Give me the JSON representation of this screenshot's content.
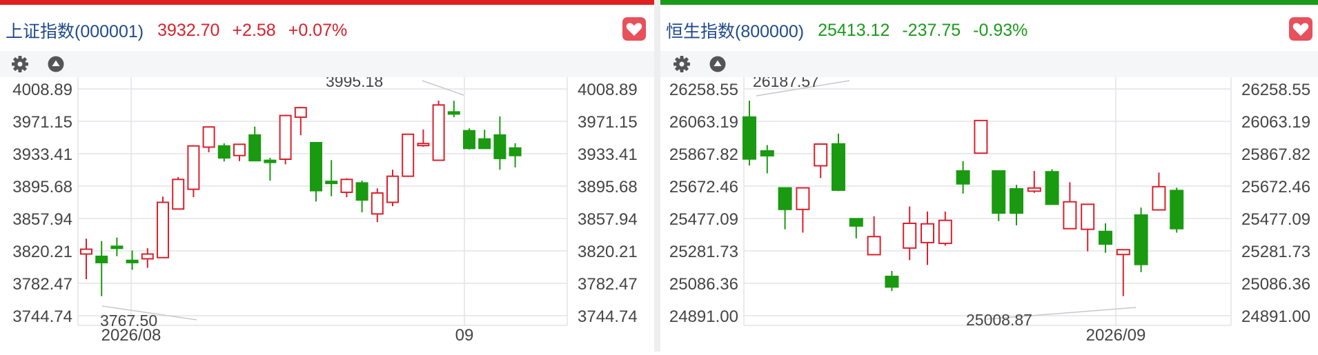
{
  "panels": [
    {
      "name": "上证指数(000001)",
      "price": "3932.70",
      "change": "+2.58",
      "change_pct": "+0.07%",
      "accent_color": "#e02020",
      "value_color": "#d9202c",
      "toolbar_icons": [
        "gear-icon",
        "triangle-up-icon"
      ],
      "favorite_icon": "heart-icon"
    },
    {
      "name": "恒生指数(800000)",
      "price": "25413.12",
      "change": "-237.75",
      "change_pct": "-0.93%",
      "accent_color": "#1a9a1a",
      "value_color": "#1a9a1a",
      "toolbar_icons": [
        "gear-icon",
        "triangle-up-icon"
      ],
      "favorite_icon": "heart-icon"
    }
  ],
  "colors": {
    "up": "#d9202c",
    "down": "#1a9a10",
    "favorite": "#e8505b",
    "grid": "#e2e4e8",
    "axis_text": "#444444"
  },
  "chart_data": [
    {
      "type": "candlestick",
      "title": "上证指数(000001)",
      "y_ticks": [
        "4008.89",
        "3971.15",
        "3933.41",
        "3895.68",
        "3857.94",
        "3820.21",
        "3782.47",
        "3744.74"
      ],
      "ylim": [
        3744.74,
        4008.89
      ],
      "x_tick_labels": [
        {
          "label": "2026/08",
          "index": 2
        },
        {
          "label": "09",
          "index": 21
        }
      ],
      "annotations": [
        {
          "text": "3995.18",
          "index": 20,
          "value": 3995.18
        },
        {
          "text": "3767.50",
          "index": 1,
          "value": 3767.5
        }
      ],
      "candles": [
        {
          "o": 3816.6,
          "h": 3834.5,
          "l": 3787.3,
          "c": 3822.2
        },
        {
          "o": 3813.9,
          "h": 3831.8,
          "l": 3767.5,
          "c": 3806.6
        },
        {
          "o": 3825.6,
          "h": 3835.7,
          "l": 3814.1,
          "c": 3823.8
        },
        {
          "o": 3809.2,
          "h": 3820.7,
          "l": 3798.2,
          "c": 3806.6
        },
        {
          "o": 3811.0,
          "h": 3823.4,
          "l": 3800.5,
          "c": 3816.6
        },
        {
          "o": 3812.4,
          "h": 3883.5,
          "l": 3812.4,
          "c": 3876.8
        },
        {
          "o": 3869.0,
          "h": 3906.3,
          "l": 3869.0,
          "c": 3903.5
        },
        {
          "o": 3892.0,
          "h": 3943.5,
          "l": 3882.8,
          "c": 3942.5
        },
        {
          "o": 3941.1,
          "h": 3965.0,
          "l": 3935.1,
          "c": 3964.6
        },
        {
          "o": 3942.5,
          "h": 3945.6,
          "l": 3924.4,
          "c": 3928.6
        },
        {
          "o": 3931.3,
          "h": 3943.0,
          "l": 3924.8,
          "c": 3944.4
        },
        {
          "o": 3955.2,
          "h": 3965.0,
          "l": 3925.8,
          "c": 3925.3
        },
        {
          "o": 3925.7,
          "h": 3928.6,
          "l": 3902.1,
          "c": 3924.8
        },
        {
          "o": 3927.0,
          "h": 3978.8,
          "l": 3921.1,
          "c": 3977.9
        },
        {
          "o": 3976.0,
          "h": 3988.0,
          "l": 3955.0,
          "c": 3987.1
        },
        {
          "o": 3946.3,
          "h": 3946.3,
          "l": 3877.7,
          "c": 3890.4
        },
        {
          "o": 3901.2,
          "h": 3926.0,
          "l": 3883.9,
          "c": 3900.3
        },
        {
          "o": 3888.5,
          "h": 3904.8,
          "l": 3882.8,
          "c": 3903.5
        },
        {
          "o": 3899.4,
          "h": 3902.1,
          "l": 3865.1,
          "c": 3879.5
        },
        {
          "o": 3863.3,
          "h": 3893.1,
          "l": 3853.8,
          "c": 3887.7
        },
        {
          "o": 3876.8,
          "h": 3914.8,
          "l": 3872.3,
          "c": 3907.2
        },
        {
          "o": 3907.2,
          "h": 3956.1,
          "l": 3907.2,
          "c": 3956.1
        },
        {
          "o": 3945.3,
          "h": 3961.6,
          "l": 3941.5,
          "c": 3945.3
        },
        {
          "o": 3925.8,
          "h": 3995.2,
          "l": 3925.8,
          "c": 3990.2
        },
        {
          "o": 3982.1,
          "h": 3995.2,
          "l": 3976.0,
          "c": 3980.7
        },
        {
          "o": 3960.2,
          "h": 3962.9,
          "l": 3938.3,
          "c": 3939.6
        },
        {
          "o": 3950.6,
          "h": 3961.4,
          "l": 3939.6,
          "c": 3939.6
        },
        {
          "o": 3955.2,
          "h": 3976.9,
          "l": 3914.8,
          "c": 3927.9
        },
        {
          "o": 3940.1,
          "h": 3945.6,
          "l": 3917.5,
          "c": 3931.3
        }
      ]
    },
    {
      "type": "candlestick",
      "title": "恒生指数(800000)",
      "y_ticks": [
        "26258.55",
        "26063.19",
        "25867.82",
        "25672.46",
        "25477.09",
        "25281.73",
        "25086.36",
        "24891.00"
      ],
      "ylim": [
        24891.0,
        26258.55
      ],
      "x_tick_labels": [
        {
          "label": "2026/09",
          "index": 21
        }
      ],
      "annotations": [
        {
          "text": "26187.57",
          "index": 0,
          "value": 26187.57
        },
        {
          "text": "25008.87",
          "index": 20,
          "value": 25008.87
        }
      ],
      "candles": [
        {
          "o": 26089.0,
          "h": 26187.6,
          "l": 25796.8,
          "c": 25836.0
        },
        {
          "o": 25885.0,
          "h": 25920.1,
          "l": 25749.5,
          "c": 25855.6
        },
        {
          "o": 25662.0,
          "h": 25662.0,
          "l": 25412.0,
          "c": 25532.0
        },
        {
          "o": 25532.0,
          "h": 25662.0,
          "l": 25392.0,
          "c": 25662.0
        },
        {
          "o": 25795.0,
          "h": 25926.0,
          "l": 25721.0,
          "c": 25926.0
        },
        {
          "o": 25927.0,
          "h": 25989.0,
          "l": 25642.0,
          "c": 25648.0
        },
        {
          "o": 25476.0,
          "h": 25476.0,
          "l": 25357.0,
          "c": 25432.0
        },
        {
          "o": 25259.0,
          "h": 25490.0,
          "l": 25259.0,
          "c": 25368.0
        },
        {
          "o": 25128.0,
          "h": 25161.0,
          "l": 25040.0,
          "c": 25064.0
        },
        {
          "o": 25299.0,
          "h": 25550.0,
          "l": 25226.0,
          "c": 25448.0
        },
        {
          "o": 25332.0,
          "h": 25519.0,
          "l": 25197.0,
          "c": 25445.0
        },
        {
          "o": 25327.0,
          "h": 25519.0,
          "l": 25313.0,
          "c": 25466.0
        },
        {
          "o": 25764.0,
          "h": 25823.0,
          "l": 25627.0,
          "c": 25686.0
        },
        {
          "o": 25871.0,
          "h": 26068.0,
          "l": 25871.0,
          "c": 26068.0
        },
        {
          "o": 25764.0,
          "h": 25764.0,
          "l": 25461.0,
          "c": 25510.0
        },
        {
          "o": 25656.0,
          "h": 25680.0,
          "l": 25436.0,
          "c": 25510.0
        },
        {
          "o": 25642.0,
          "h": 25764.0,
          "l": 25632.0,
          "c": 25661.0
        },
        {
          "o": 25759.0,
          "h": 25774.0,
          "l": 25559.0,
          "c": 25563.0
        },
        {
          "o": 25416.0,
          "h": 25696.0,
          "l": 25416.0,
          "c": 25578.0
        },
        {
          "o": 25412.0,
          "h": 25563.0,
          "l": 25279.0,
          "c": 25563.0
        },
        {
          "o": 25399.0,
          "h": 25448.0,
          "l": 25271.0,
          "c": 25323.0
        },
        {
          "o": 25260.0,
          "h": 25289.0,
          "l": 25008.9,
          "c": 25289.0
        },
        {
          "o": 25498.0,
          "h": 25543.0,
          "l": 25154.0,
          "c": 25200.0
        },
        {
          "o": 25529.0,
          "h": 25754.0,
          "l": 25529.0,
          "c": 25669.0
        },
        {
          "o": 25646.0,
          "h": 25663.0,
          "l": 25392.0,
          "c": 25416.0
        }
      ]
    }
  ]
}
